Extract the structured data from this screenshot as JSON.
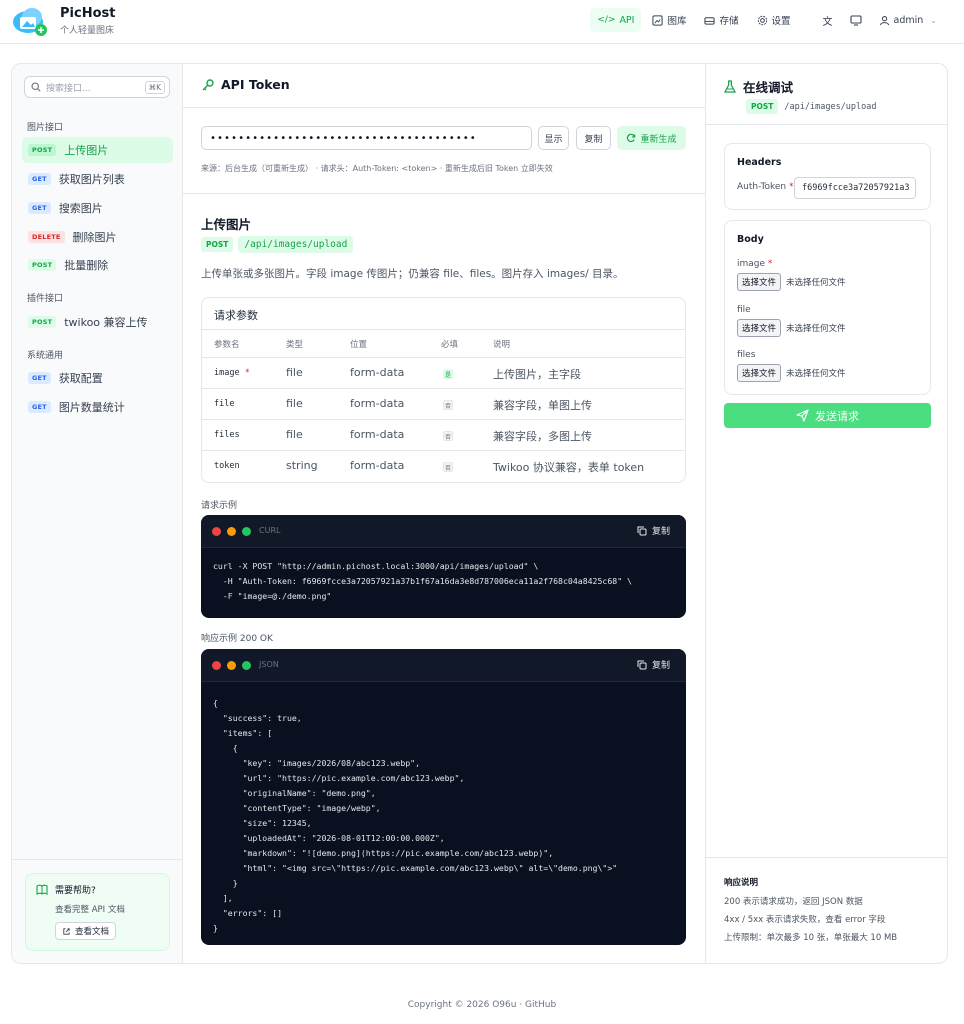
{
  "brand": {
    "name": "PicHost",
    "subtitle": "个人轻量图床"
  },
  "nav": {
    "api": "API",
    "gallery": "图库",
    "storage": "存储",
    "settings": "设置",
    "user": "admin"
  },
  "sidebar": {
    "search_placeholder": "搜索接口...",
    "search_shortcut": "⌘K",
    "groups": [
      {
        "title": "图片接口",
        "items": [
          {
            "method": "POST",
            "label": "上传图片"
          },
          {
            "method": "GET",
            "label": "获取图片列表"
          },
          {
            "method": "GET",
            "label": "搜索图片"
          },
          {
            "method": "DELETE",
            "label": "删除图片"
          },
          {
            "method": "POST",
            "label": "批量删除"
          }
        ]
      },
      {
        "title": "插件接口",
        "items": [
          {
            "method": "POST",
            "label": "twikoo 兼容上传"
          }
        ]
      },
      {
        "title": "系统通用",
        "items": [
          {
            "method": "GET",
            "label": "获取配置"
          },
          {
            "method": "GET",
            "label": "图片数量统计"
          }
        ]
      }
    ],
    "help": {
      "title": "需要帮助?",
      "desc": "查看完整 API 文档",
      "button": "查看文档"
    }
  },
  "token": {
    "title": "API Token",
    "value": "••••••••••••••••••••••••••••••••••••••",
    "show": "显示",
    "copy": "复制",
    "regen": "重新生成",
    "note": "来源：后台生成（可重新生成） · 请求头：Auth-Token: <token> · 重新生成后旧 Token 立即失效"
  },
  "endpoint": {
    "title": "上传图片",
    "method": "POST",
    "path": "/api/images/upload",
    "description": "上传单张或多张图片。字段 image 传图片；仍兼容 file、files。图片存入 images/ 目录。"
  },
  "params": {
    "title": "请求参数",
    "headers": [
      "参数名",
      "类型",
      "位置",
      "必填",
      "说明"
    ],
    "rows": [
      {
        "name": "image",
        "required": true,
        "req_mark": "是",
        "type": "file",
        "position": "form-data",
        "desc": "上传图片，主字段"
      },
      {
        "name": "file",
        "required": false,
        "req_mark": "否",
        "type": "file",
        "position": "form-data",
        "desc": "兼容字段，单图上传"
      },
      {
        "name": "files",
        "required": false,
        "req_mark": "否",
        "type": "file",
        "position": "form-data",
        "desc": "兼容字段，多图上传"
      },
      {
        "name": "token",
        "required": false,
        "req_mark": "否",
        "type": "string",
        "position": "form-data",
        "desc": "Twikoo 协议兼容，表单 token"
      }
    ]
  },
  "request_example": {
    "label": "请求示例",
    "lang": "CURL",
    "copy": "复制",
    "code": "curl -X POST \"http://admin.pichost.local:3000/api/images/upload\" \\\n  -H \"Auth-Token: f6969fcce3a72057921a37b1f67a16da3e8d787006eca11a2f768c04a8425c68\" \\\n  -F \"image=@./demo.png\""
  },
  "response_example": {
    "label": "响应示例 200 OK",
    "lang": "JSON",
    "copy": "复制",
    "code": "{\n  \"success\": true,\n  \"items\": [\n    {\n      \"key\": \"images/2026/08/abc123.webp\",\n      \"url\": \"https://pic.example.com/abc123.webp\",\n      \"originalName\": \"demo.png\",\n      \"contentType\": \"image/webp\",\n      \"size\": 12345,\n      \"uploadedAt\": \"2026-08-01T12:00:00.000Z\",\n      \"markdown\": \"![demo.png](https://pic.example.com/abc123.webp)\",\n      \"html\": \"<img src=\\\"https://pic.example.com/abc123.webp\\\" alt=\\\"demo.png\\\">\"\n    }\n  ],\n  \"errors\": []\n}"
  },
  "debug": {
    "title": "在线调试",
    "method": "POST",
    "path": "/api/images/upload",
    "headers_title": "Headers",
    "auth_label": "Auth-Token",
    "auth_value": "f6969fcce3a72057921a3",
    "body_title": "Body",
    "fields": [
      {
        "name": "image",
        "required": true,
        "button": "选择文件",
        "status": "未选择任何文件"
      },
      {
        "name": "file",
        "required": false,
        "button": "选择文件",
        "status": "未选择任何文件"
      },
      {
        "name": "files",
        "required": false,
        "button": "选择文件",
        "status": "未选择任何文件"
      }
    ],
    "send": "发送请求",
    "response_title": "响应说明",
    "response_lines": [
      "200 表示请求成功，返回 JSON 数据",
      "4xx / 5xx 表示请求失败，查看 error 字段",
      "上传限制：单次最多 10 张，单张最大 10 MB"
    ]
  },
  "footer": "Copyright © 2026 O96u · GitHub",
  "colors": {
    "accent": "#16a34a",
    "accent_bg": "#dcfce7",
    "code_bg": "#0b1020"
  }
}
